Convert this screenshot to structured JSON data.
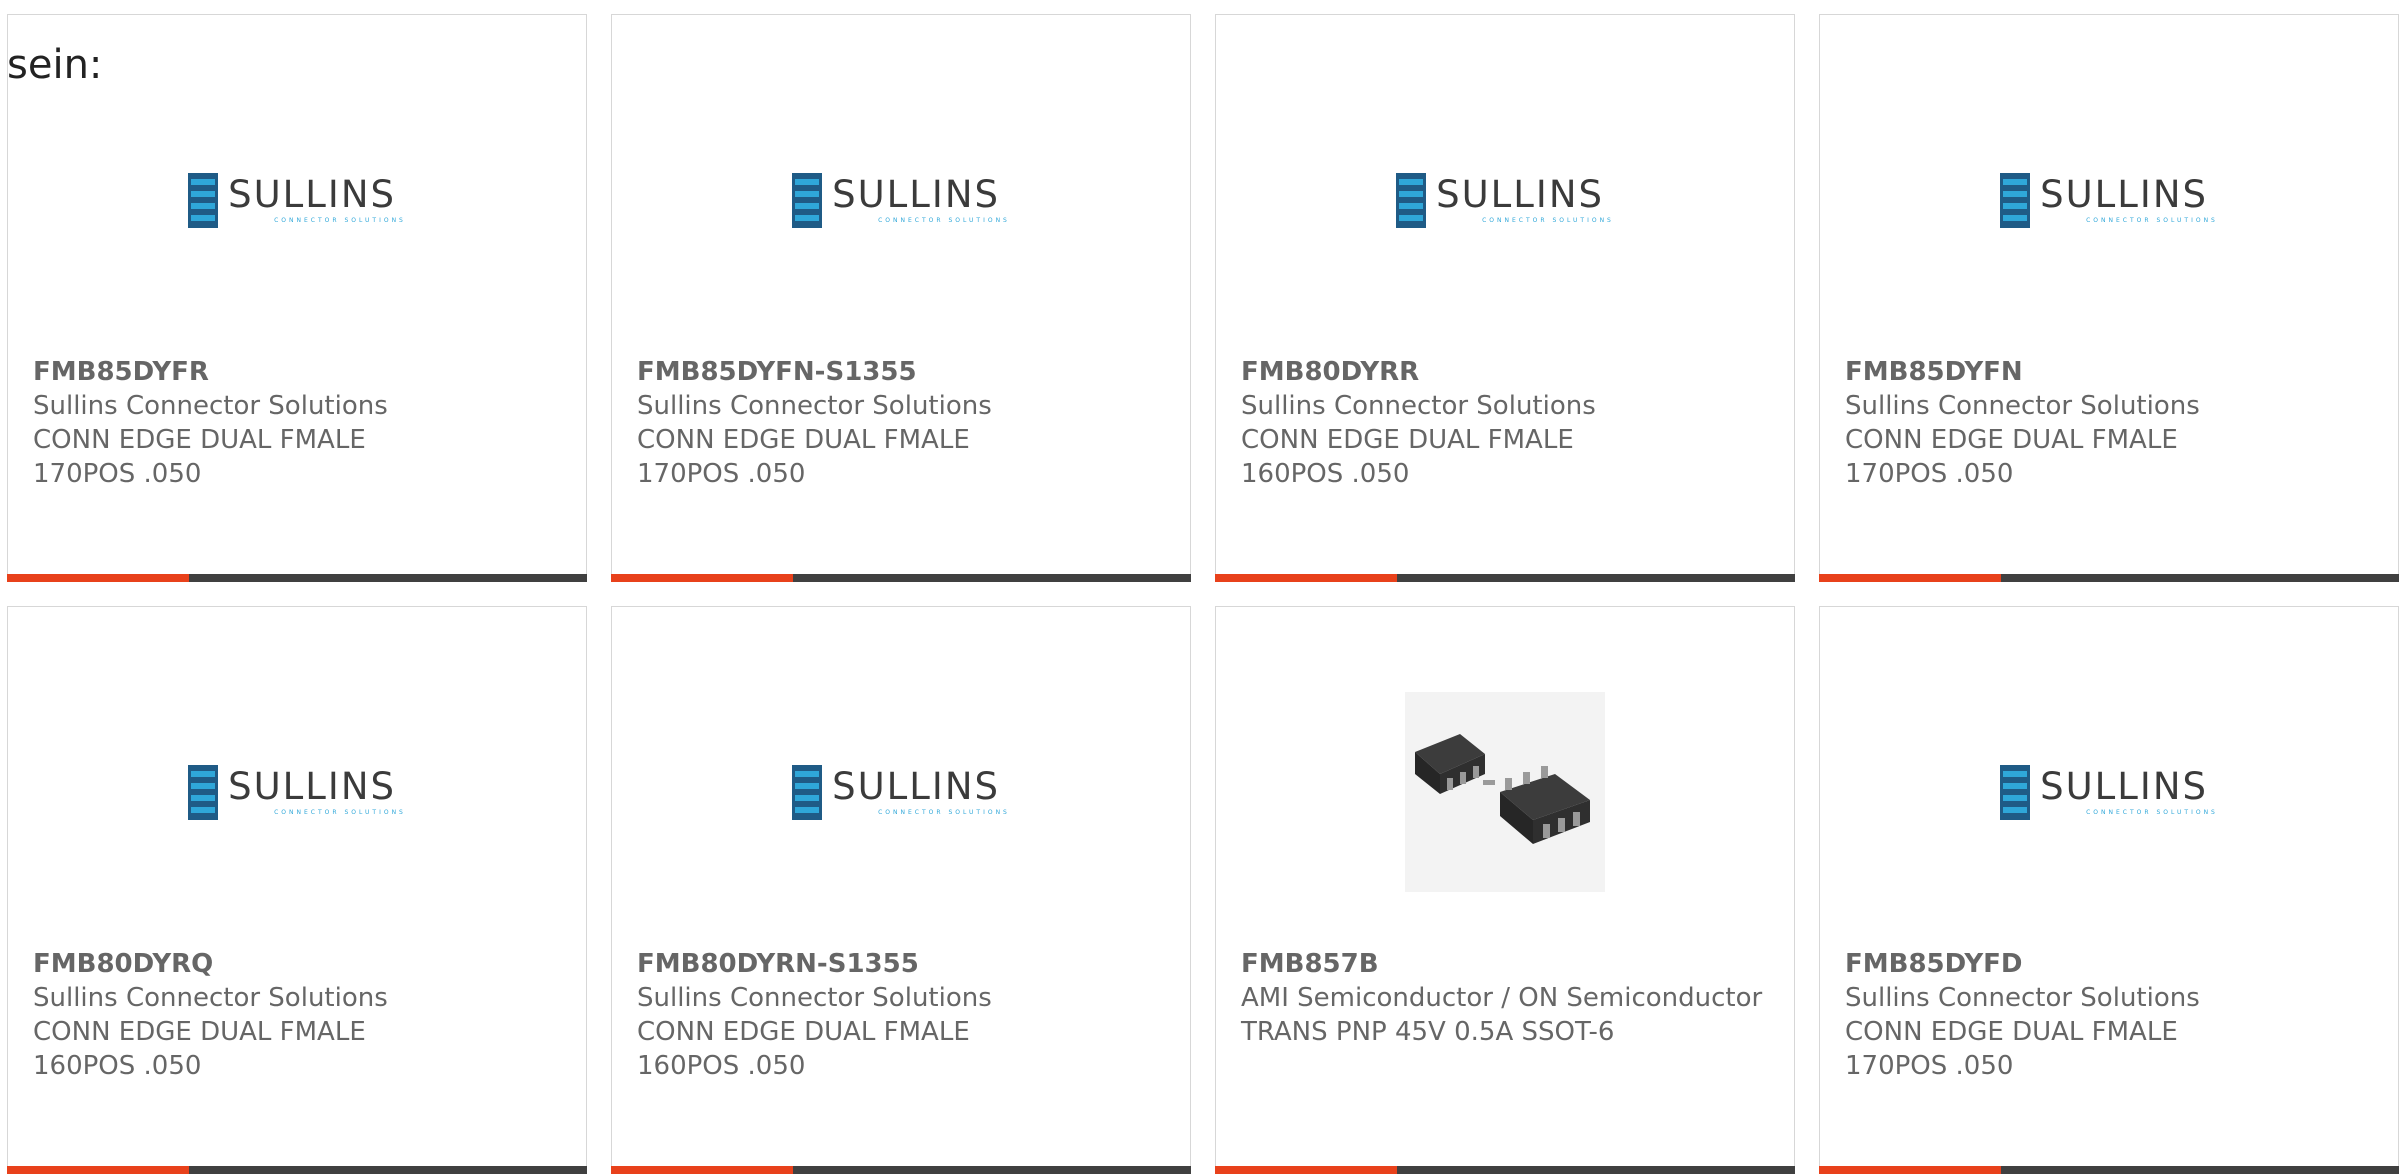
{
  "intro_text": "sein:",
  "colors": {
    "accent": "#e8411b",
    "bar": "#404040",
    "text": "#666666",
    "logo_dark": "#1f5b86",
    "logo_light": "#2fa7d9"
  },
  "logo": {
    "word": "SULLINS",
    "sub": "CONNECTOR SOLUTIONS"
  },
  "products": [
    {
      "part": "FMB85DYFR",
      "manufacturer": "Sullins Connector Solutions",
      "desc1": "CONN EDGE DUAL FMALE",
      "desc2": "170POS .050",
      "image": "sullins-logo"
    },
    {
      "part": "FMB85DYFN-S1355",
      "manufacturer": "Sullins Connector Solutions",
      "desc1": "CONN EDGE DUAL FMALE",
      "desc2": "170POS .050",
      "image": "sullins-logo"
    },
    {
      "part": "FMB80DYRR",
      "manufacturer": "Sullins Connector Solutions",
      "desc1": "CONN EDGE DUAL FMALE",
      "desc2": "160POS .050",
      "image": "sullins-logo"
    },
    {
      "part": "FMB85DYFN",
      "manufacturer": "Sullins Connector Solutions",
      "desc1": "CONN EDGE DUAL FMALE",
      "desc2": "170POS .050",
      "image": "sullins-logo"
    },
    {
      "part": "FMB80DYRQ",
      "manufacturer": "Sullins Connector Solutions",
      "desc1": "CONN EDGE DUAL FMALE",
      "desc2": "160POS .050",
      "image": "sullins-logo"
    },
    {
      "part": "FMB80DYRN-S1355",
      "manufacturer": "Sullins Connector Solutions",
      "desc1": "CONN EDGE DUAL FMALE",
      "desc2": "160POS .050",
      "image": "sullins-logo"
    },
    {
      "part": "FMB857B",
      "manufacturer": "AMI Semiconductor / ON Semiconductor",
      "desc1": "TRANS PNP 45V 0.5A SSOT-6",
      "desc2": "",
      "image": "chip-photo"
    },
    {
      "part": "FMB85DYFD",
      "manufacturer": "Sullins Connector Solutions",
      "desc1": "CONN EDGE DUAL FMALE",
      "desc2": "170POS .050",
      "image": "sullins-logo"
    }
  ]
}
